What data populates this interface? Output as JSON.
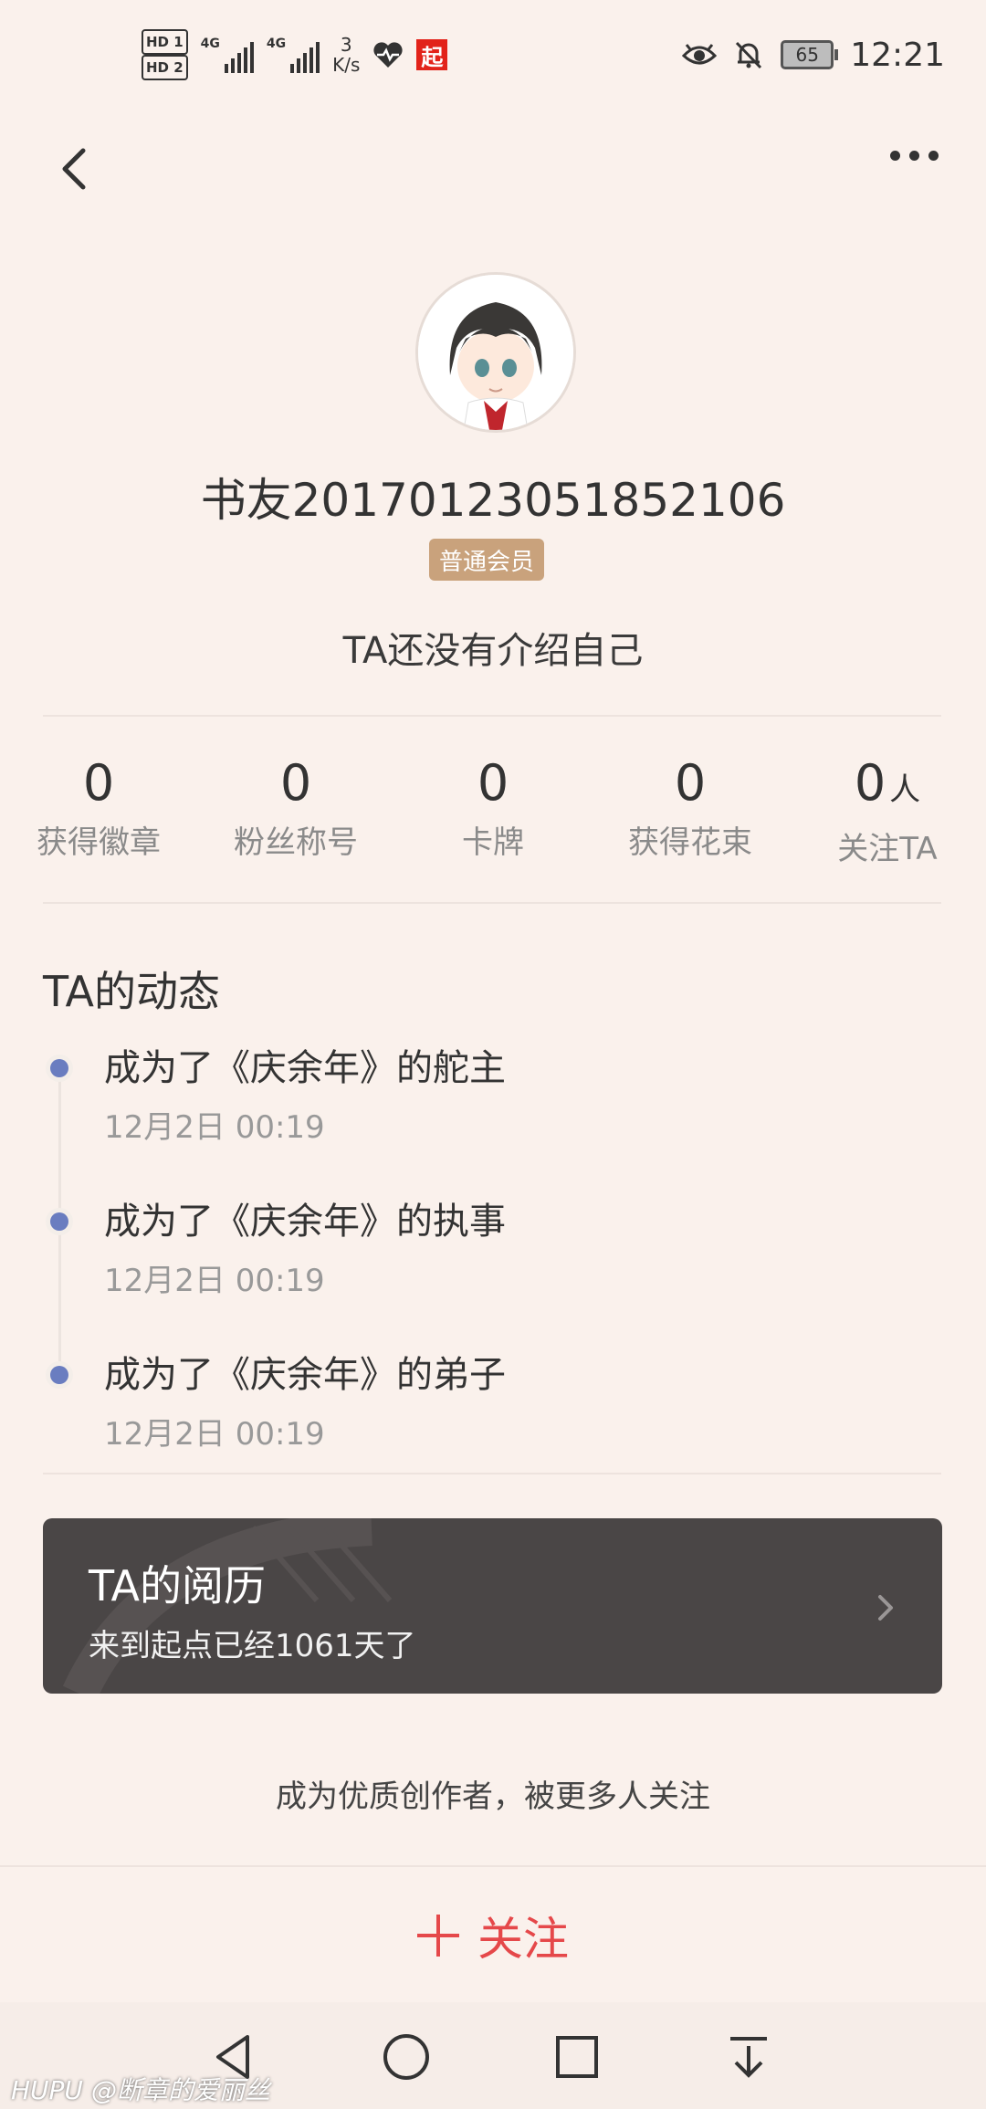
{
  "status_bar": {
    "hd1": "HD 1",
    "hd2": "HD 2",
    "net1": "4G",
    "net2": "4G",
    "speed_value": "3",
    "speed_unit": "K/s",
    "app_badge": "起",
    "battery": "65",
    "time": "12:21"
  },
  "profile": {
    "name": "书友20170123051852106",
    "member_badge": "普通会员",
    "bio": "TA还没有介绍自己"
  },
  "stats": [
    {
      "value": "0",
      "unit": "",
      "label": "获得徽章"
    },
    {
      "value": "0",
      "unit": "",
      "label": "粉丝称号"
    },
    {
      "value": "0",
      "unit": "",
      "label": "卡牌"
    },
    {
      "value": "0",
      "unit": "",
      "label": "获得花束"
    },
    {
      "value": "0",
      "unit": "人",
      "label": "关注TA"
    }
  ],
  "activity": {
    "title": "TA的动态",
    "items": [
      {
        "text": "成为了《庆余年》的舵主",
        "time": "12月2日 00:19"
      },
      {
        "text": "成为了《庆余年》的执事",
        "time": "12月2日 00:19"
      },
      {
        "text": "成为了《庆余年》的弟子",
        "time": "12月2日 00:19"
      }
    ]
  },
  "reading_card": {
    "title": "TA的阅历",
    "subtitle": "来到起点已经1061天了"
  },
  "promo_text": "成为优质创作者，被更多人关注",
  "follow_button": {
    "label": "关注"
  },
  "watermark": "HUPU @断章的爱丽丝",
  "colors": {
    "background": "#faf1ec",
    "accent_red": "#e5484a",
    "badge_gold": "#c9a27c",
    "timeline_dot": "#6a7dc0",
    "card_bg": "#4a4646"
  }
}
